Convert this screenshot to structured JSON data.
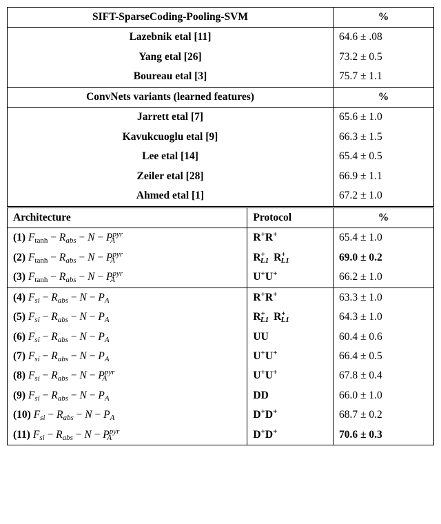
{
  "chart_data": {
    "type": "table",
    "title": "",
    "sections": [
      {
        "header": {
          "label": "SIFT-SparseCoding-Pooling-SVM",
          "metric": "%"
        },
        "rows": [
          {
            "method": "Lazebnik etal  [11]",
            "value": "64.6 ± .08"
          },
          {
            "method": "Yang etal  [26]",
            "value": "73.2 ± 0.5"
          },
          {
            "method": "Boureau etal  [3]",
            "value": "75.7 ± 1.1"
          }
        ]
      },
      {
        "header": {
          "label": "ConvNets variants (learned features)",
          "metric": "%"
        },
        "rows": [
          {
            "method": "Jarrett etal  [7]",
            "value": "65.6 ± 1.0"
          },
          {
            "method": "Kavukcuoglu etal  [9]",
            "value": "66.3 ± 1.5"
          },
          {
            "method": "Lee etal [14]",
            "value": "65.4 ± 0.5"
          },
          {
            "method": "Zeiler etal  [28]",
            "value": "66.9 ± 1.1"
          },
          {
            "method": "Ahmed etal  [1]",
            "value": "67.2 ± 1.0"
          }
        ]
      }
    ],
    "full_header": {
      "c1": "Architecture",
      "c2": "Protocol",
      "c3": "%"
    },
    "arch_rows_group1": [
      {
        "idx": "(1)",
        "arch_type": "tanh_pyr",
        "proto": "R+R+",
        "value": "65.4 ± 1.0",
        "bold": false
      },
      {
        "idx": "(2)",
        "arch_type": "tanh_pyr",
        "proto": "RL1+RL1+",
        "value": "69.0 ± 0.2",
        "bold": true
      },
      {
        "idx": "(3)",
        "arch_type": "tanh_pyr",
        "proto": "U+U+",
        "value": "66.2 ± 1.0",
        "bold": false
      }
    ],
    "arch_rows_group2": [
      {
        "idx": "(4)",
        "arch_type": "si",
        "proto": "R+R+",
        "value": "63.3 ± 1.0",
        "bold": false
      },
      {
        "idx": "(5)",
        "arch_type": "si",
        "proto": "RL1+RL1+",
        "value": "64.3 ± 1.0",
        "bold": false
      },
      {
        "idx": "(6)",
        "arch_type": "si",
        "proto": "UU",
        "value": "60.4 ± 0.6",
        "bold": false
      },
      {
        "idx": "(7)",
        "arch_type": "si",
        "proto": "U+U+",
        "value": "66.4 ± 0.5",
        "bold": false
      },
      {
        "idx": "(8)",
        "arch_type": "si_pyr",
        "proto": "U+U+",
        "value": "67.8 ± 0.4",
        "bold": false
      },
      {
        "idx": "(9)",
        "arch_type": "si",
        "proto": "DD",
        "value": "66.0 ± 1.0",
        "bold": false
      },
      {
        "idx": "(10)",
        "arch_type": "si",
        "proto": "D+D+",
        "value": "68.7 ± 0.2",
        "bold": false
      },
      {
        "idx": "(11)",
        "arch_type": "si_pyr",
        "proto": "D+D+",
        "value": "70.6 ± 0.3",
        "bold": true
      }
    ],
    "arch_strings": {
      "tanh_pyr": "F_tanh − R_abs − N − P_A^pyr",
      "si": "F_si − R_abs − N − P_A",
      "si_pyr": "F_si − R_abs − N − P_A^pyr"
    }
  }
}
